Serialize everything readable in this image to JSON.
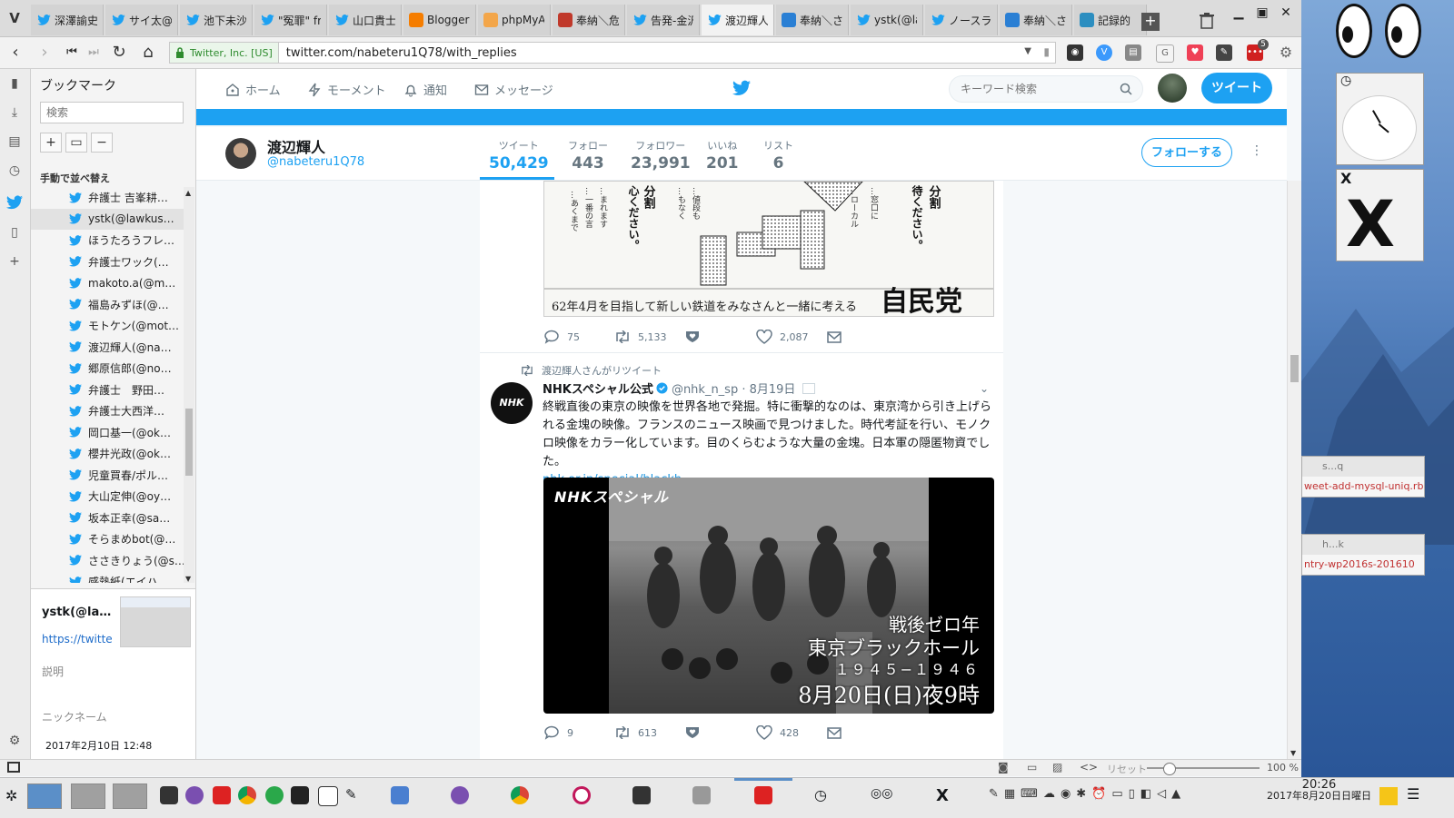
{
  "browser": {
    "tabs": [
      {
        "label": "深澤諭史",
        "icon": "twitter"
      },
      {
        "label": "サイ太@",
        "icon": "twitter"
      },
      {
        "label": "池下未沙",
        "icon": "twitter"
      },
      {
        "label": "\"冤罪\" fr",
        "icon": "twitter"
      },
      {
        "label": "山口貴士",
        "icon": "twitter"
      },
      {
        "label": "Blogger:",
        "icon": "blogger"
      },
      {
        "label": "phpMyA",
        "icon": "phpmyadmin"
      },
      {
        "label": "奉納＼危",
        "icon": "site"
      },
      {
        "label": "告発-金沢",
        "icon": "twitter"
      },
      {
        "label": "渡辺輝人",
        "icon": "twitter",
        "active": true
      },
      {
        "label": "奉納＼さ",
        "icon": "site-b"
      },
      {
        "label": "ystk(@la",
        "icon": "twitter"
      },
      {
        "label": "ノースラ・",
        "icon": "twitter"
      },
      {
        "label": "奉納＼さ",
        "icon": "site-b"
      },
      {
        "label": "記録的",
        "icon": "site-c"
      }
    ],
    "cert_label": "Twitter, Inc. [US]",
    "url": "twitter.com/nabeteru1Q78/with_replies",
    "ext_badge": "5",
    "zoom": "100 %",
    "reset_label": "リセット"
  },
  "bookmarks": {
    "title": "ブックマーク",
    "search_placeholder": "検索",
    "tool_add": "+",
    "tool_folder": "▭",
    "tool_remove": "−",
    "sort_label": "手動で並べ替え",
    "items": [
      "弁護士 吉峯耕…",
      "ystk(@lawkus…",
      "ほうたろうフレ…",
      "弁護士ワック(…",
      "makoto.a(@m…",
      "福島みずほ(@…",
      "モトケン(@mot…",
      "渡辺輝人(@na…",
      "郷原信郎(@no…",
      "弁護士　野田…",
      "弁護士大西洋…",
      "岡口基一(@ok…",
      "櫻井光政(@ok…",
      "児童買春/ポル…",
      "大山定伸(@oy…",
      "坂本正幸(@sa…",
      "そらまめbot(@…",
      "ささきりょう(@s…",
      "感熱紙(エイハ…"
    ],
    "selected_index": 1,
    "detail": {
      "name": "ystk(@la…",
      "url": "https://twitte",
      "desc_label": "説明",
      "nick_label": "ニックネーム",
      "date": "2017年2月10日 12:48"
    }
  },
  "twitter": {
    "nav": {
      "home": "ホーム",
      "moments": "モーメント",
      "notifications": "通知",
      "messages": "メッセージ"
    },
    "search_placeholder": "キーワード検索",
    "tweet_button": "ツイート",
    "profile": {
      "name": "渡辺輝人",
      "handle": "@nabeteru1Q78",
      "stats": [
        {
          "label": "ツイート",
          "value": "50,429"
        },
        {
          "label": "フォロー",
          "value": "443"
        },
        {
          "label": "フォロワー",
          "value": "23,991"
        },
        {
          "label": "いいね",
          "value": "201"
        },
        {
          "label": "リスト",
          "value": "6"
        }
      ],
      "follow_button": "フォローする"
    },
    "tweet1": {
      "poster_caption": "62年4月を目指して新しい鉄道をみなさんと一緒に考える",
      "poster_party": "自民党",
      "poster_head1": "分割",
      "poster_head2": "心ください。",
      "poster_head3": "分割",
      "poster_head4": "待ください。",
      "replies": "75",
      "retweets": "5,133",
      "likes": "2,087"
    },
    "tweet2": {
      "retweet_note": "渡辺輝人さんがリツイート",
      "avatar_text": "NHK",
      "author": "NHKスペシャル公式",
      "handle_date": "@nhk_n_sp · 8月19日",
      "text": "終戦直後の東京の映像を世界各地で発掘。特に衝撃的なのは、東京湾から引き上げられる金塊の映像。フランスのニュース映画で見つけました。時代考証を行い、モノクロ映像をカラー化しています。目のくらむような大量の金塊。日本軍の隠匿物資でした。",
      "link": "nhk.or.jp/special/blackh…",
      "media": {
        "logo": "NHKスペシャル",
        "line1": "戦後ゼロ年",
        "line2": "東京ブラックホール",
        "line3": "１９４５−１９４６",
        "line4": "8月20日(日)夜9時"
      },
      "replies": "9",
      "retweets": "613",
      "likes": "428"
    }
  },
  "desktop": {
    "notif1_title": "s...q",
    "notif1_body": "weet-add-mysql-uniq.rb",
    "notif2_title": "h...k",
    "notif2_body": "ntry-wp2016s-201610"
  },
  "taskbar": {
    "time": "20:26",
    "date": "2017年8月20日日曜日"
  }
}
